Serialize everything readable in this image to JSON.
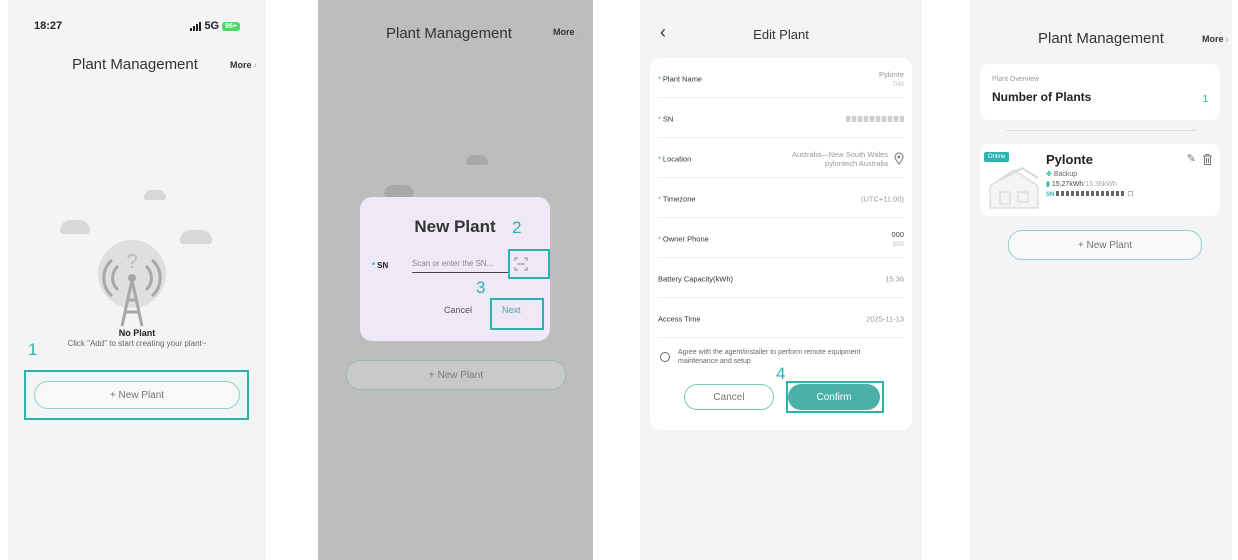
{
  "screen1": {
    "status_time": "18:27",
    "status_network": "5G",
    "status_battery": "96+",
    "title": "Plant Management",
    "more": "More",
    "no_plant": "No Plant",
    "hint": "Click \"Add\" to start creating your plant~",
    "new_plant_btn": "+ New Plant",
    "step": "1"
  },
  "screen2": {
    "title": "Plant Management",
    "more": "More",
    "dialog_title": "New Plant",
    "sn_label": "SN",
    "sn_placeholder": "Scan or enter the SN...",
    "cancel": "Cancel",
    "next": "Next",
    "new_plant_btn": "+ New Plant",
    "step2": "2",
    "step3": "3"
  },
  "screen3": {
    "title": "Edit Plant",
    "fields": [
      {
        "label": "Plant Name",
        "value": "Pylonte",
        "sub": "7/40",
        "required": true
      },
      {
        "label": "SN",
        "value": "",
        "sub": "",
        "required": true
      },
      {
        "label": "Location",
        "value": "Australia—New South Wales",
        "sub": "pylontech Australia",
        "required": true
      },
      {
        "label": "Timezone",
        "value": "(UTC+11:00)",
        "sub": "",
        "required": true
      },
      {
        "label": "Owner Phone",
        "value": "000",
        "sub": "3/20",
        "required": true
      },
      {
        "label": "Battery Capacity(kWh)",
        "value": "15.36",
        "sub": "",
        "required": false
      },
      {
        "label": "Access Time",
        "value": "2025-11-13",
        "sub": "",
        "required": false
      }
    ],
    "agree_text": "Agree with the agent/installer to perform remote equipment maintenance and setup",
    "cancel": "Cancel",
    "confirm": "Confirm",
    "step": "4"
  },
  "screen4": {
    "title": "Plant Management",
    "more": "More",
    "overview_label": "Plant Overview",
    "overview_title": "Number of Plants",
    "overview_count": "1",
    "plant_status": "Online",
    "plant_name": "Pylonte",
    "plant_type": "Backup",
    "plant_energy": "15.27kWh",
    "plant_capacity": "/15.36kWh",
    "sn_tag": "SN",
    "new_plant_btn": "+ New Plant"
  },
  "colors": {
    "accent": "#2ab3b0",
    "confirm": "#4bb0a8",
    "online": "#2ab3b0"
  },
  "icons": [
    "back-chevron-icon",
    "scan-icon",
    "location-pin-icon",
    "edit-pencil-icon",
    "delete-trash-icon",
    "fan-icon",
    "battery-icon",
    "copy-icon",
    "radio-tower-icon",
    "house-icon"
  ]
}
